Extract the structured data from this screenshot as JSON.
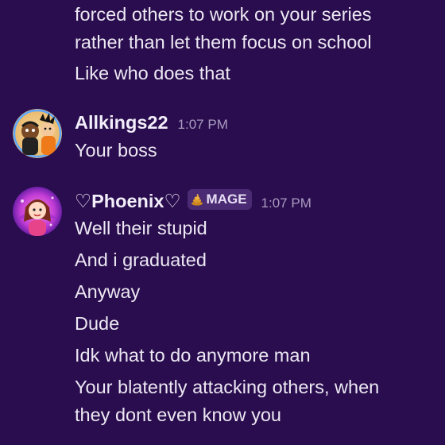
{
  "messages": {
    "continued": {
      "lines": [
        "forced others to work on your series",
        "rather than let them focus on school",
        "Like who does that"
      ]
    },
    "group1": {
      "author": "Allkings22",
      "time": "1:07 PM",
      "lines": [
        "Your boss"
      ]
    },
    "group2": {
      "author": "♡Phoenix♡",
      "badge": {
        "label": "MAGE",
        "icon": "poop-emoji-icon"
      },
      "time": "1:07 PM",
      "lines": [
        "Well their stupid",
        "And i graduated",
        "Anyway",
        "Dude",
        "Idk what to do anymore man",
        "Your blatently attacking others, when",
        "they dont even know you"
      ]
    }
  },
  "colors": {
    "background": "#2a0d4e",
    "text": "#ece8f3",
    "timestamp": "#a99cc0",
    "badge_bg": "#4a2a72"
  }
}
